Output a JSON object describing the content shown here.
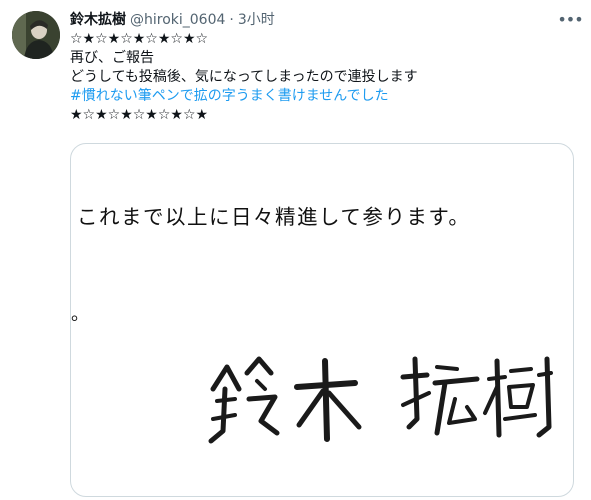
{
  "tweet": {
    "author": {
      "display_name": "鈴木拡樹",
      "handle": "@hiroki_0604"
    },
    "separator": "·",
    "timestamp": "3小时",
    "more_label": "•••",
    "lines": [
      "☆★☆★☆★☆★☆★☆",
      "再び、ご報告",
      "どうしても投稿後、気になってしまったので連投します"
    ],
    "hashtag": "#慣れない筆ペンで拡の字うまく書けませんでした",
    "closing_line": "★☆★☆★☆★☆★☆★"
  },
  "media": {
    "document_text": "これまで以上に日々精進して参ります。",
    "stray_mark": "。",
    "signature": "鈴木 拡樹"
  },
  "colors": {
    "text": "#0f1419",
    "secondary": "#536471",
    "link": "#1d9bf0",
    "border": "#cfd9de"
  }
}
